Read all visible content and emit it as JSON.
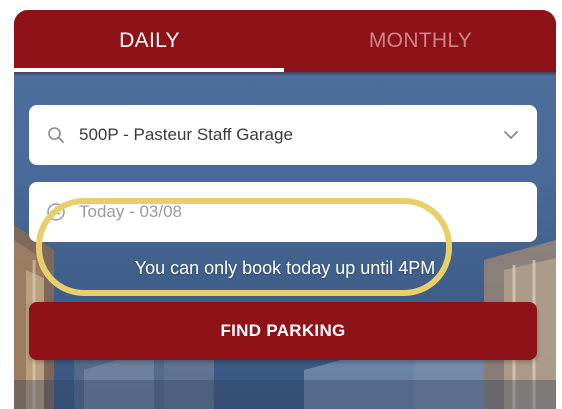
{
  "tabs": [
    {
      "label": "DAILY",
      "active": true
    },
    {
      "label": "MONTHLY",
      "active": false
    }
  ],
  "location_field": {
    "value": "500P - Pasteur Staff Garage",
    "icon": "search-icon",
    "dropdown_icon": "chevron-down-icon"
  },
  "date_field": {
    "value": "Today - 03/08",
    "icon": "clock-icon"
  },
  "notice": "You can only book today up until 4PM",
  "find_button": {
    "label": "FIND PARKING"
  },
  "colors": {
    "brand_red": "#8f1218",
    "inactive_tab_text": "#c9868a",
    "highlight_yellow": "#e8cf6a",
    "background_blue": "#4a6b99"
  }
}
